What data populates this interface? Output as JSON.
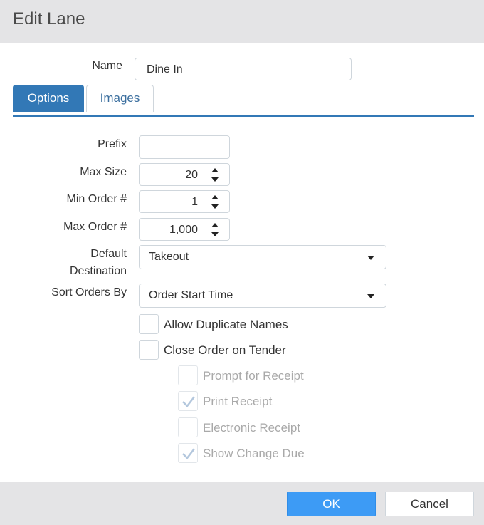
{
  "dialog": {
    "title": "Edit Lane"
  },
  "name_field": {
    "label": "Name",
    "value": "Dine In"
  },
  "tabs": [
    {
      "label": "Options",
      "active": true
    },
    {
      "label": "Images",
      "active": false
    }
  ],
  "options": {
    "prefix": {
      "label": "Prefix",
      "value": ""
    },
    "max_size": {
      "label": "Max Size",
      "value": "20"
    },
    "min_order": {
      "label": "Min Order #",
      "value": "1"
    },
    "max_order": {
      "label": "Max Order #",
      "value": "1,000"
    },
    "default_destination": {
      "label_line1": "Default",
      "label_line2": "Destination",
      "value": "Takeout"
    },
    "sort_orders_by": {
      "label": "Sort Orders By",
      "value": "Order Start Time"
    }
  },
  "checkboxes": [
    {
      "label": "Allow Duplicate Names",
      "checked": false,
      "disabled": false
    },
    {
      "label": "Close Order on Tender",
      "checked": false,
      "disabled": false
    },
    {
      "label": "Prompt for Receipt",
      "checked": false,
      "disabled": true
    },
    {
      "label": "Print Receipt",
      "checked": true,
      "disabled": true
    },
    {
      "label": "Electronic Receipt",
      "checked": false,
      "disabled": true
    },
    {
      "label": "Show Change Due",
      "checked": true,
      "disabled": true
    }
  ],
  "footer": {
    "ok_label": "OK",
    "cancel_label": "Cancel"
  },
  "colors": {
    "accent": "#3278b6",
    "ok_button": "#3d9bf5",
    "header_bg": "#e4e4e6"
  }
}
